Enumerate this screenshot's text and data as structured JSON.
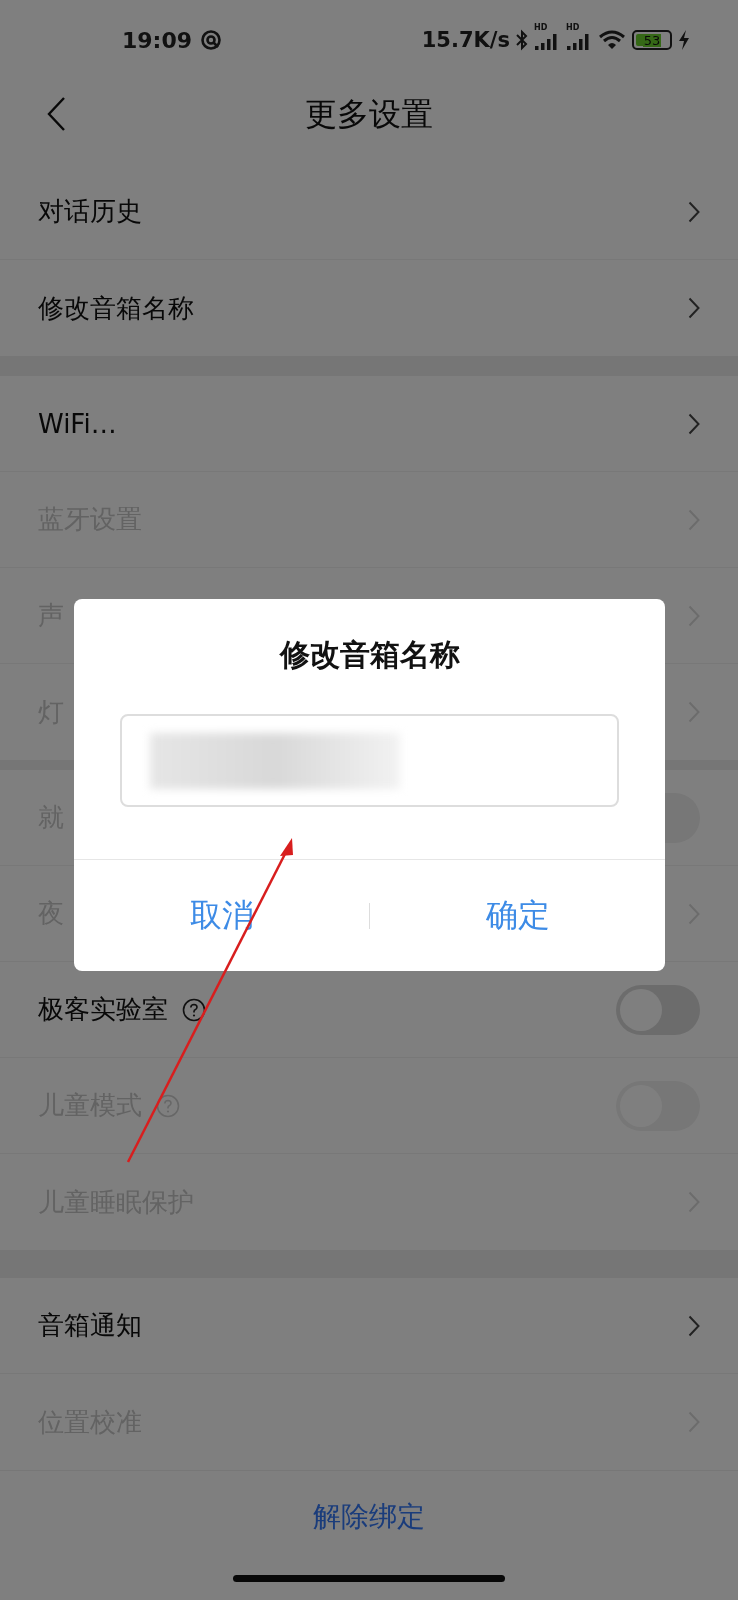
{
  "status_bar": {
    "time": "19:09",
    "speed": "15.7K/s",
    "signals": [
      {
        "label": "HD"
      },
      {
        "label": "HD"
      }
    ],
    "battery": "53"
  },
  "header": {
    "title": "更多设置"
  },
  "groups": [
    {
      "items": [
        {
          "label": "对话历史",
          "kind": "link",
          "disabled": false
        },
        {
          "label": "修改音箱名称",
          "kind": "link",
          "disabled": false
        }
      ]
    },
    {
      "items": [
        {
          "label": "WiFi…",
          "kind": "link",
          "disabled": false
        },
        {
          "label": "蓝牙设置",
          "kind": "link",
          "disabled": true
        },
        {
          "label": "声",
          "kind": "link",
          "disabled": true
        },
        {
          "label": "灯",
          "kind": "link",
          "disabled": true
        }
      ]
    },
    {
      "items": [
        {
          "label": "就",
          "kind": "toggle",
          "disabled": true,
          "on": false
        },
        {
          "label": "夜",
          "kind": "link",
          "disabled": true
        },
        {
          "label": "极客实验室",
          "kind": "toggle",
          "disabled": false,
          "on": false,
          "help": true
        },
        {
          "label": "儿童模式",
          "kind": "toggle",
          "disabled": true,
          "on": false,
          "help": true
        },
        {
          "label": "儿童睡眠保护",
          "kind": "link",
          "disabled": true
        }
      ]
    },
    {
      "items": [
        {
          "label": "音箱通知",
          "kind": "link",
          "disabled": false
        },
        {
          "label": "位置校准",
          "kind": "link",
          "disabled": true
        }
      ]
    }
  ],
  "footer": {
    "action": "解除绑定"
  },
  "dialog": {
    "title": "修改音箱名称",
    "buttons": [
      {
        "label": "取消"
      },
      {
        "label": "确定"
      }
    ]
  }
}
